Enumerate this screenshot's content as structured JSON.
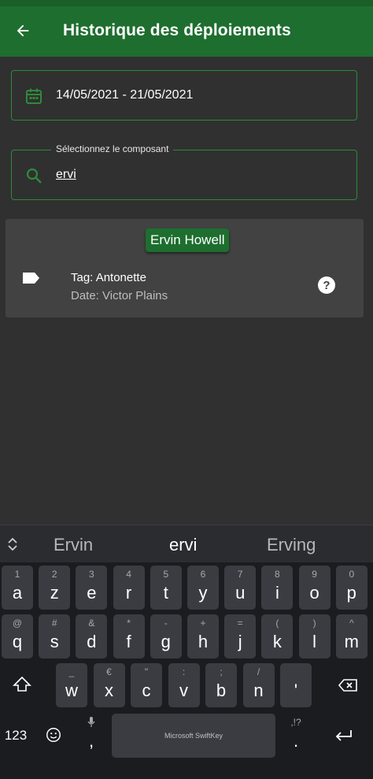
{
  "app_bar": {
    "title": "Historique des déploiements"
  },
  "date_range": {
    "value": "14/05/2021 - 21/05/2021"
  },
  "component_search": {
    "label": "Sélectionnez le composant",
    "value": "ervi"
  },
  "result_card": {
    "name": "Ervin Howell",
    "tag_line": "Tag: Antonette",
    "date_line": "Date: Victor Plains"
  },
  "colors": {
    "primary": "#1e6e2f",
    "outline": "#2f8a3a",
    "background": "#303030",
    "card": "#424242"
  },
  "keyboard": {
    "suggestions": [
      "Ervin",
      "ervi",
      "Erving"
    ],
    "row1": [
      {
        "k": "a",
        "h": "1"
      },
      {
        "k": "z",
        "h": "2"
      },
      {
        "k": "e",
        "h": "3"
      },
      {
        "k": "r",
        "h": "4"
      },
      {
        "k": "t",
        "h": "5"
      },
      {
        "k": "y",
        "h": "6"
      },
      {
        "k": "u",
        "h": "7"
      },
      {
        "k": "i",
        "h": "8"
      },
      {
        "k": "o",
        "h": "9"
      },
      {
        "k": "p",
        "h": "0"
      }
    ],
    "row2": [
      {
        "k": "q",
        "h": "@"
      },
      {
        "k": "s",
        "h": "#"
      },
      {
        "k": "d",
        "h": "&"
      },
      {
        "k": "f",
        "h": "*"
      },
      {
        "k": "g",
        "h": "-"
      },
      {
        "k": "h",
        "h": "+"
      },
      {
        "k": "j",
        "h": "="
      },
      {
        "k": "k",
        "h": "("
      },
      {
        "k": "l",
        "h": ")"
      },
      {
        "k": "m",
        "h": "^"
      }
    ],
    "row3": [
      {
        "k": "w",
        "h": "_"
      },
      {
        "k": "x",
        "h": "€"
      },
      {
        "k": "c",
        "h": "\""
      },
      {
        "k": "v",
        "h": ":"
      },
      {
        "k": "b",
        "h": ";"
      },
      {
        "k": "n",
        "h": "/"
      },
      {
        "k": "'",
        "h": ""
      }
    ],
    "numbers_key": "123",
    "comma_key": ",",
    "period_key": ".",
    "period_hint": ",!?",
    "space_label": "Microsoft SwiftKey"
  }
}
